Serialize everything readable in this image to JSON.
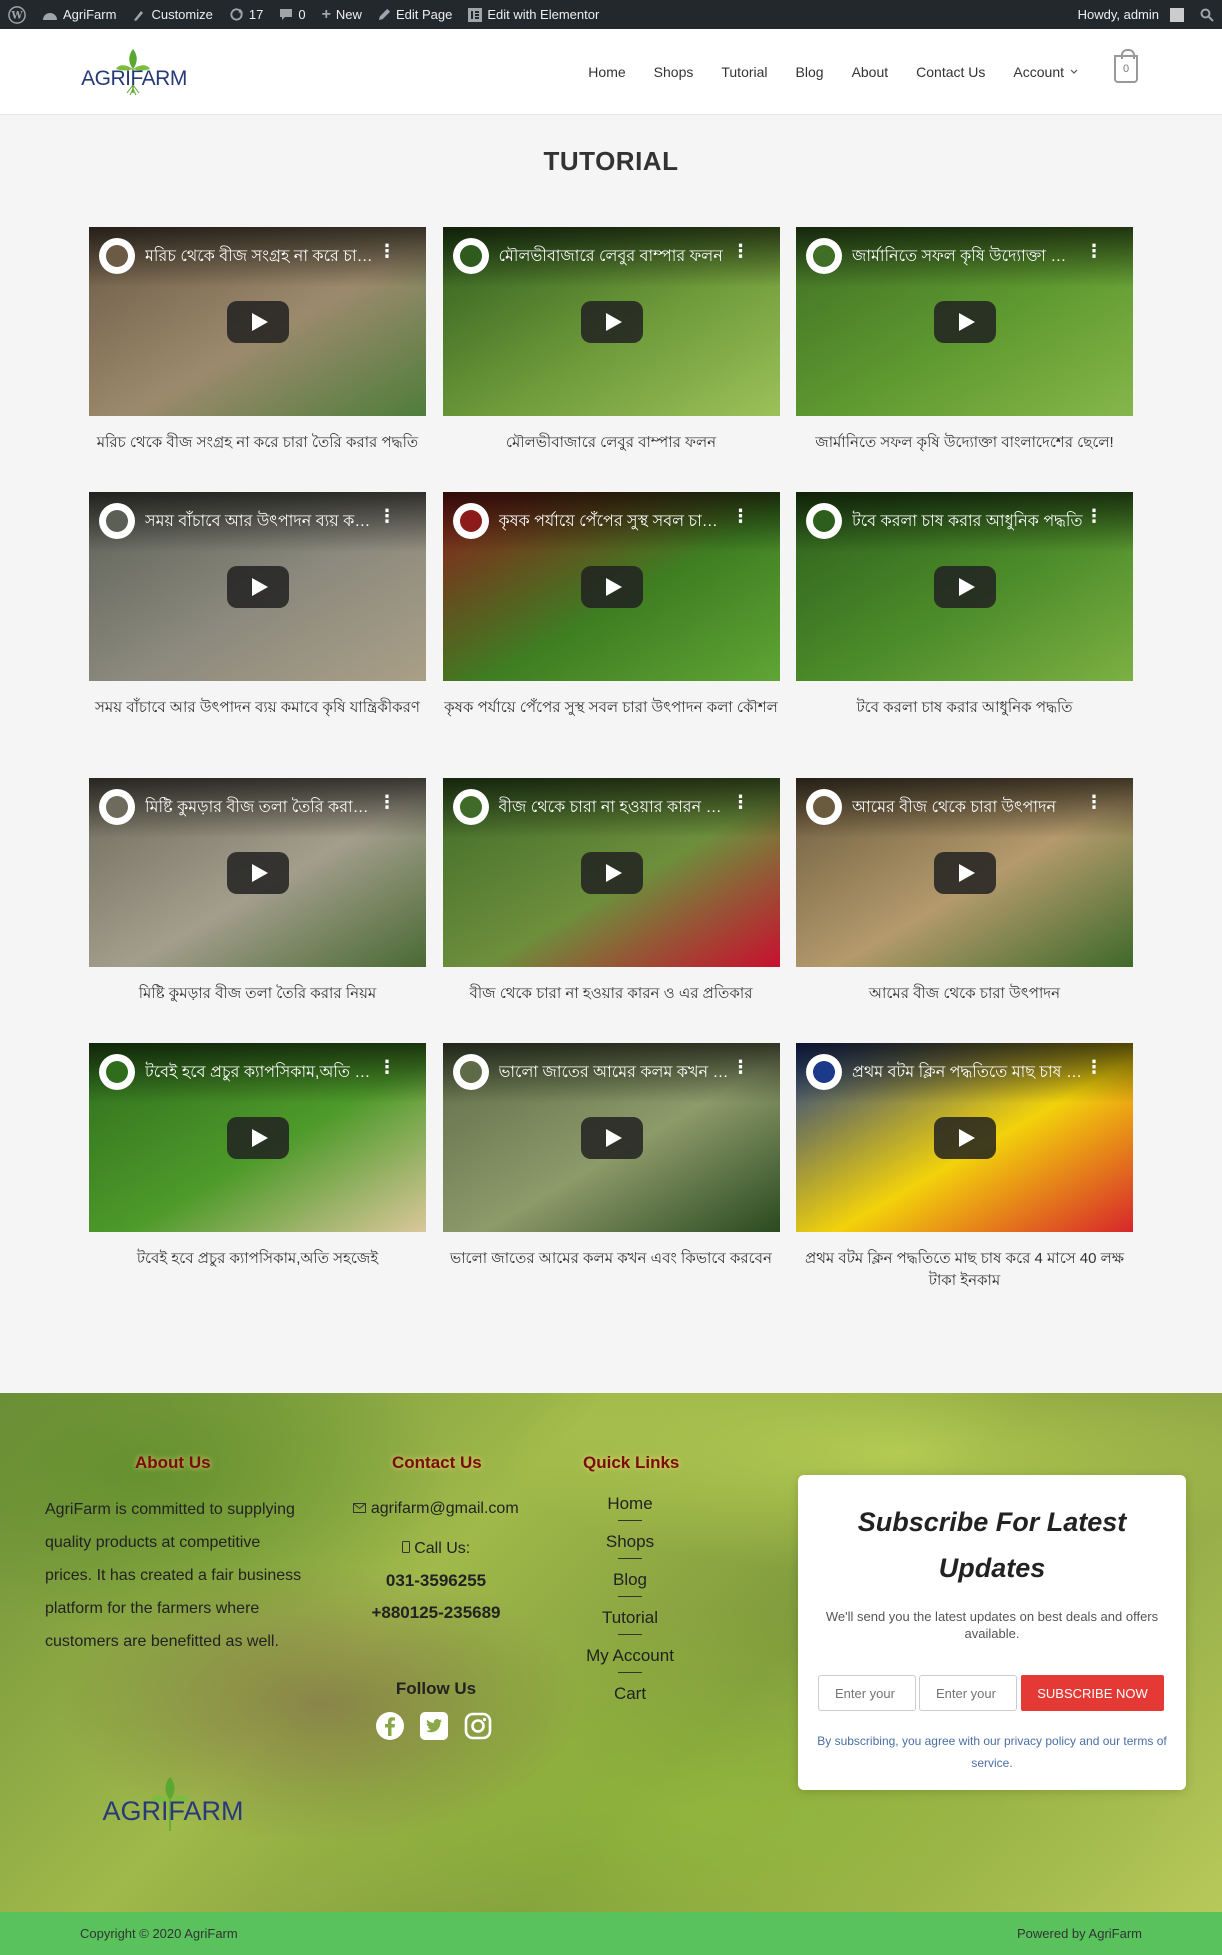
{
  "admin_bar": {
    "site": "AgriFarm",
    "customize": "Customize",
    "updates": "17",
    "comments": "0",
    "new": "New",
    "edit_page": "Edit Page",
    "elementor": "Edit with Elementor",
    "howdy": "Howdy, admin"
  },
  "header": {
    "nav": [
      "Home",
      "Shops",
      "Tutorial",
      "Blog",
      "About",
      "Contact Us",
      "Account"
    ],
    "cart_count": "0",
    "logo_text": "AGRIFARM"
  },
  "page": {
    "title": "TUTORIAL"
  },
  "videos": [
    {
      "title": "মরিচ থেকে বীজ সংগ্রহ না করে চারা তৈরি করার পদ্ধতি",
      "caption": "মরিচ থেকে বীজ সংগ্রহ না করে চারা তৈরি করার পদ্ধতি",
      "colors": [
        "#6b5a46",
        "#9b8a6c",
        "#4f7d3c"
      ]
    },
    {
      "title": "মৌলভীবাজারে লেবুর বাম্পার ফলন",
      "caption": "মৌলভীবাজারে লেবুর বাম্পার ফলন",
      "colors": [
        "#2f5b1e",
        "#6e9a3a",
        "#9bc15a"
      ]
    },
    {
      "title": "জার্মানিতে সফল কৃষি উদ্যোক্তা বাংলাদেশের ছেলে!",
      "caption": "জার্মানিতে সফল কৃষি উদ্যোক্তা বাংলাদেশের ছেলে!",
      "colors": [
        "#3f6e24",
        "#5f9a30",
        "#86b64a"
      ]
    },
    {
      "title": "সময় বাঁচাবে আর উৎপাদন ব্যয় কমাবে কৃষি যান্ত্রিকীকরণ",
      "caption": "সময় বাঁচাবে আর উৎপাদন ব্যয় কমাবে কৃষি যান্ত্রিকীকরণ",
      "colors": [
        "#5c5f56",
        "#8c8a7e",
        "#aa9f86"
      ]
    },
    {
      "title": "কৃষক পর্যায়ে পেঁপের সুস্থ সবল চারা উৎপাদন কলা কৌশল",
      "caption": "কৃষক পর্যায়ে পেঁপের সুস্থ সবল চারা উৎপাদন কলা কৌশল",
      "colors": [
        "#8e1b1b",
        "#3f7d22",
        "#5fa534"
      ]
    },
    {
      "title": "টবে করলা চাষ করার আধুনিক পদ্ধতি",
      "caption": "টবে করলা চাষ করার আধুনিক পদ্ধতি",
      "colors": [
        "#2c5e1c",
        "#4d8c2a",
        "#7cb043"
      ]
    },
    {
      "title": "মিষ্টি কুমড়ার বীজ তলা তৈরি করার নিয়ম",
      "caption": "মিষ্টি কুমড়ার বীজ তলা তৈরি করার নিয়ম",
      "colors": [
        "#6e6a5c",
        "#a39e8c",
        "#4a6a34"
      ]
    },
    {
      "title": "বীজ থেকে চারা না হওয়ার কারন ও এর প্রতিকার",
      "caption": "বীজ থেকে চারা না হওয়ার কারন ও এর প্রতিকার",
      "colors": [
        "#3f6a28",
        "#6d8f3c",
        "#c8102e"
      ]
    },
    {
      "title": "আমের বীজ থেকে চারা উৎপাদন",
      "caption": "আমের বীজ থেকে চারা উৎপাদন",
      "colors": [
        "#6a5a3e",
        "#b49a6c",
        "#3f6a2a"
      ]
    },
    {
      "title": "টবেই হবে প্রচুর ক্যাপসিকাম,অতি সহজেই",
      "caption": "টবেই হবে প্রচুর ক্যাপসিকাম,অতি সহজেই",
      "colors": [
        "#2f6d1d",
        "#4e9a2a",
        "#d9c79a"
      ]
    },
    {
      "title": "ভালো জাতের আমের কলম কখন এবং কিভাবে করবেন",
      "caption": "ভালো জাতের আমের কলম কখন এবং কিভাবে করবেন",
      "colors": [
        "#5e6b48",
        "#8d9a6a",
        "#2a4a20"
      ]
    },
    {
      "title": "প্রথম বটম ক্লিন পদ্ধতিতে মাছ চাষ করে 4 মাসে 40 লক্ষ টাকা ইনকাম",
      "caption": "প্রথম বটম ক্লিন পদ্ধতিতে মাছ চাষ করে 4 মাসে 40 লক্ষ টাকা ইনকাম",
      "colors": [
        "#1d3a8a",
        "#f2d20b",
        "#d7262b"
      ]
    }
  ],
  "footer": {
    "about_title": "About Us",
    "about_text": "AgriFarm is committed to supplying quality products at competitive prices. It has created a fair business platform for the farmers where customers are benefitted as well.",
    "contact_title": "Contact Us",
    "email": "agrifarm@gmail.com",
    "call_label": "Call Us:",
    "phone1": "031-3596255",
    "phone2": "+880125-235689",
    "follow_title": "Follow Us",
    "links_title": "Quick Links",
    "links": [
      "Home",
      "Shops",
      "Blog",
      "Tutorial",
      "My Account",
      "Cart"
    ],
    "logo_text": "AGRIFARM",
    "subscribe": {
      "title": "Subscribe For Latest Updates",
      "desc": "We'll send you the latest updates on best deals and offers available.",
      "input1_placeholder": "Enter your",
      "input2_placeholder": "Enter your",
      "button": "SUBSCRIBE NOW",
      "note": "By subscribing, you agree with our privacy policy and our terms of service."
    }
  },
  "bottom": {
    "copyright": "Copyright © 2020 AgriFarm",
    "powered": "Powered by AgriFarm"
  }
}
